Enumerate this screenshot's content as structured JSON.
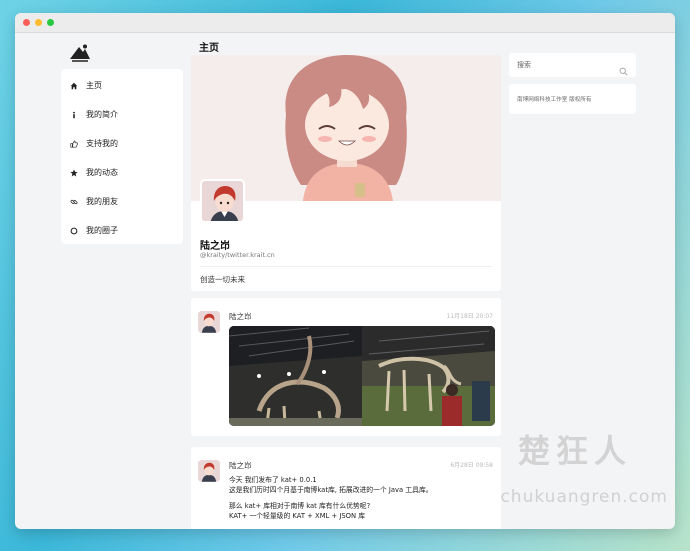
{
  "page": {
    "title": "主页"
  },
  "nav": {
    "items": [
      {
        "label": "主页",
        "icon": "home-icon"
      },
      {
        "label": "我的简介",
        "icon": "info-icon"
      },
      {
        "label": "支持我的",
        "icon": "thumbs-up-icon"
      },
      {
        "label": "我的动态",
        "icon": "star-icon"
      },
      {
        "label": "我的朋友",
        "icon": "link-icon"
      },
      {
        "label": "我的圈子",
        "icon": "circle-icon"
      }
    ]
  },
  "profile": {
    "name": "陆之岇",
    "handle": "@kraity/twitter.krait.cn",
    "bio": "创造一切未来"
  },
  "posts": [
    {
      "author": "陆之岇",
      "time": "11月18日 20:07"
    },
    {
      "author": "陆之岇",
      "time": "6月28日 09:58",
      "lines": [
        "今天 我们发布了 kat+ 0.0.1",
        "这是我们历时四个月基于南博kat库, 拓展改进的一个 Java 工具库。",
        "那么 kat+ 库相对于南博 kat 库有什么优势呢?",
        "KAT+ 一个轻量级的 KAT + XML + JSON 库"
      ]
    }
  ],
  "search": {
    "placeholder": "搜索"
  },
  "sidebar": {
    "copyright": "南博网络科技工作室 版权所有"
  },
  "watermark": {
    "cn": "楚狂人",
    "en": "chukuangren.com"
  },
  "colors": {
    "accent": "#3bb7d8",
    "window_bg": "#f3f4f6",
    "card_bg": "#ffffff"
  }
}
